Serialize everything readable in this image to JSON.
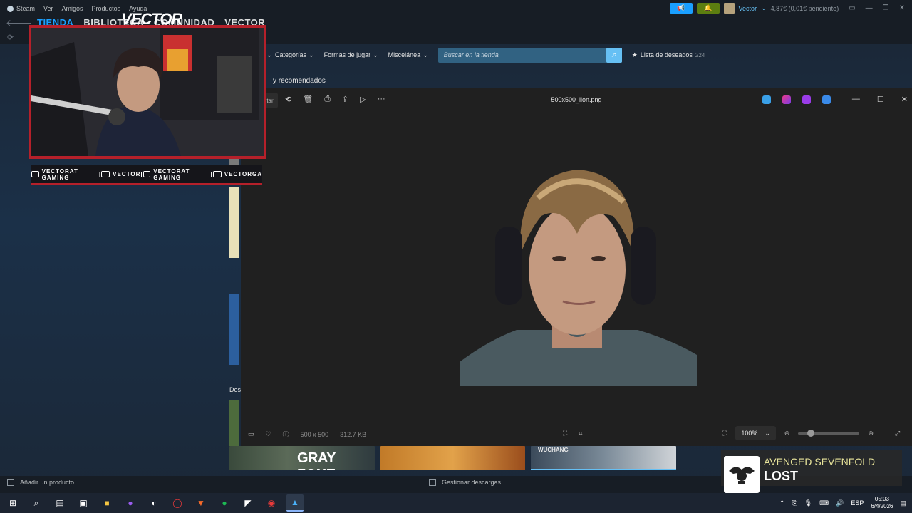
{
  "steam": {
    "menu": [
      "Steam",
      "Ver",
      "Amigos",
      "Productos",
      "Ayuda"
    ],
    "tabs": [
      "TIENDA",
      "BIBLIOTECA",
      "COMUNIDAD",
      "VECTOR"
    ],
    "user": "Vector",
    "wallet": "4,87€ (0,01€ pendiente)",
    "store_nav": [
      "Categorías",
      "Formas de jugar",
      "Miscelánea"
    ],
    "search_placeholder": "Buscar en la tienda",
    "wishlist_label": "Lista de deseados",
    "wishlist_count": "224",
    "section_title": "y recomendados",
    "left_label": "Des",
    "add_product": "Añadir un producto",
    "downloads": "Gestionar descargas",
    "banners": [
      "GRAY ZONE",
      "WUCHANG"
    ]
  },
  "viewer": {
    "filename": "500x500_lion.png",
    "dimensions": "500 x 500",
    "filesize": "312.7 KB",
    "zoom": "100%",
    "zoom_level": 0.15,
    "left_button": "tar",
    "icons": [
      "rotate-icon",
      "delete-icon",
      "print-icon",
      "share-icon",
      "slideshow-icon",
      "more-icon"
    ]
  },
  "stream": {
    "title": "VECTOR",
    "socials": [
      {
        "icon": "youtube-icon",
        "label": "VECTORAT GAMING"
      },
      {
        "icon": "twitch-icon",
        "label": "VECTOR"
      },
      {
        "icon": "twitter-icon",
        "label": "VECTORAT GAMING"
      },
      {
        "icon": "instagram-icon",
        "label": "VECTORGA"
      }
    ]
  },
  "now_playing": {
    "artist": "AVENGED SEVENFOLD",
    "song": "LOST"
  },
  "taskbar": {
    "lang": "ESP",
    "time": "05:03",
    "date": "6/4/2026"
  }
}
